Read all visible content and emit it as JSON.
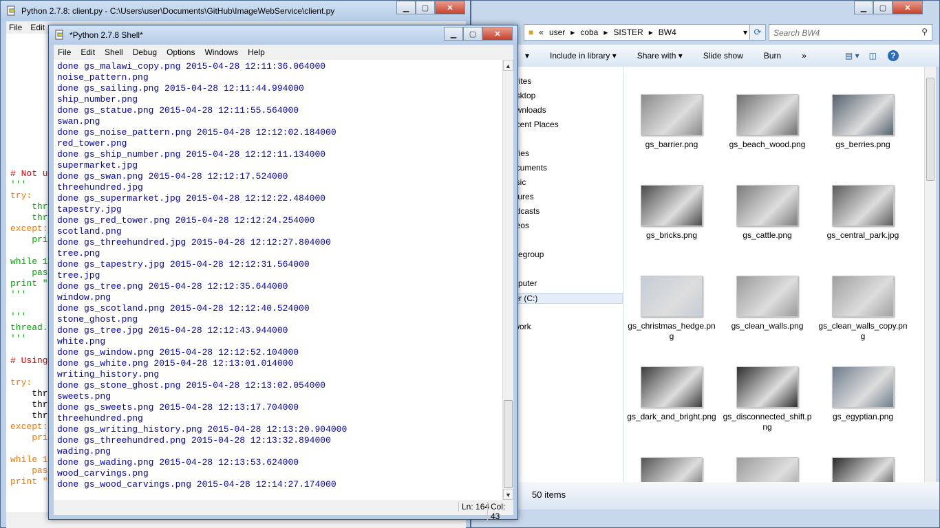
{
  "editor": {
    "title": "Python 2.7.8: client.py - C:\\Users\\user\\Documents\\GitHub\\ImageWebService\\client.py",
    "menu": [
      "File",
      "Edit"
    ],
    "code_lines": [
      {
        "text": "# Not u",
        "cls": "c-com"
      },
      {
        "text": "'''",
        "cls": "c-str"
      },
      {
        "text": "try:",
        "cls": "c-kw"
      },
      {
        "text": "    thre",
        "cls": "c-str"
      },
      {
        "text": "    thre",
        "cls": "c-str"
      },
      {
        "text": "except:",
        "cls": "c-kw"
      },
      {
        "text": "    pri",
        "cls": "c-str"
      },
      {
        "text": "",
        "cls": "c-pl"
      },
      {
        "text": "while 1",
        "cls": "c-str"
      },
      {
        "text": "    pas",
        "cls": "c-str"
      },
      {
        "text": "print \"",
        "cls": "c-str"
      },
      {
        "text": "'''",
        "cls": "c-str"
      },
      {
        "text": "",
        "cls": "c-pl"
      },
      {
        "text": "'''",
        "cls": "c-str"
      },
      {
        "text": "thread.",
        "cls": "c-str"
      },
      {
        "text": "'''",
        "cls": "c-str"
      },
      {
        "text": "",
        "cls": "c-pl"
      },
      {
        "text": "# Using",
        "cls": "c-com"
      },
      {
        "text": "",
        "cls": "c-pl"
      },
      {
        "text": "try:",
        "cls": "c-kw"
      },
      {
        "text": "    thr",
        "cls": "c-pl"
      },
      {
        "text": "    thr",
        "cls": "c-pl"
      },
      {
        "text": "    thr",
        "cls": "c-pl"
      },
      {
        "text": "except:",
        "cls": "c-kw"
      },
      {
        "text": "    pri",
        "cls": "c-kw"
      },
      {
        "text": "",
        "cls": "c-pl"
      },
      {
        "text": "while 1",
        "cls": "c-kw"
      },
      {
        "text": "    pas",
        "cls": "c-kw"
      },
      {
        "text": "print \"",
        "cls": "c-kw"
      }
    ]
  },
  "shell": {
    "title": "*Python 2.7.8 Shell*",
    "menu": [
      "File",
      "Edit",
      "Shell",
      "Debug",
      "Options",
      "Windows",
      "Help"
    ],
    "lines": [
      "done gs_malawi_copy.png 2015-04-28 12:11:36.064000",
      "noise_pattern.png",
      "done gs_sailing.png 2015-04-28 12:11:44.994000",
      "ship_number.png",
      "done gs_statue.png 2015-04-28 12:11:55.564000",
      "swan.png",
      "done gs_noise_pattern.png 2015-04-28 12:12:02.184000",
      "red_tower.png",
      "done gs_ship_number.png 2015-04-28 12:12:11.134000",
      "supermarket.jpg",
      "done gs_swan.png 2015-04-28 12:12:17.524000",
      "threehundred.jpg",
      "done gs_supermarket.jpg 2015-04-28 12:12:22.484000",
      "tapestry.jpg",
      "done gs_red_tower.png 2015-04-28 12:12:24.254000",
      "scotland.png",
      "done gs_threehundred.jpg 2015-04-28 12:12:27.804000",
      "tree.png",
      "done gs_tapestry.jpg 2015-04-28 12:12:31.564000",
      "tree.jpg",
      "done gs_tree.png 2015-04-28 12:12:35.644000",
      "window.png",
      "done gs_scotland.png 2015-04-28 12:12:40.524000",
      "stone_ghost.png",
      "done gs_tree.jpg 2015-04-28 12:12:43.944000",
      "white.png",
      "done gs_window.png 2015-04-28 12:12:52.104000",
      "done gs_white.png 2015-04-28 12:13:01.014000",
      "writing_history.png",
      "done gs_stone_ghost.png 2015-04-28 12:13:02.054000",
      "sweets.png",
      "done gs_sweets.png 2015-04-28 12:13:17.704000",
      "threehundred.png",
      "done gs_writing_history.png 2015-04-28 12:13:20.904000",
      "done gs_threehundred.png 2015-04-28 12:13:32.894000",
      "wading.png",
      "done gs_wading.png 2015-04-28 12:13:53.624000",
      "wood_carvings.png",
      "done gs_wood_carvings.png 2015-04-28 12:14:27.174000"
    ],
    "status_ln": "Ln: 164",
    "status_col": "Col: 43"
  },
  "explorer": {
    "breadcrumb": [
      "«",
      "user",
      "coba",
      "SISTER",
      "BW4"
    ],
    "search_placeholder": "Search BW4",
    "toolbar": {
      "include": "Include in library ▾",
      "share": "Share with ▾",
      "slideshow": "Slide show",
      "burn": "Burn",
      "more": "»"
    },
    "nav": [
      "orites",
      "esktop",
      "ownloads",
      "ecent Places",
      "aries",
      "ocuments",
      "usic",
      "ctures",
      "odcasts",
      "deos",
      "megroup",
      "mputer",
      "ter (C:)",
      "twork"
    ],
    "files": [
      {
        "name": "gs_barrier.png",
        "tone": "#8a8a8a"
      },
      {
        "name": "gs_beach_wood.png",
        "tone": "#6f6f6f"
      },
      {
        "name": "gs_berries.png",
        "tone": "#55626e"
      },
      {
        "name": "gs_bricks.png",
        "tone": "#4a4a4a"
      },
      {
        "name": "gs_cattle.png",
        "tone": "#7b7b7b"
      },
      {
        "name": "gs_central_park.jpg",
        "tone": "#5c5c5c"
      },
      {
        "name": "gs_christmas_hedge.png",
        "tone": "#c5cdd6"
      },
      {
        "name": "gs_clean_walls.png",
        "tone": "#9a9a9a"
      },
      {
        "name": "gs_clean_walls_copy.png",
        "tone": "#a0a0a0"
      },
      {
        "name": "gs_dark_and_bright.png",
        "tone": "#3d3d3d"
      },
      {
        "name": "gs_disconnected_shift.png",
        "tone": "#2f2f2f"
      },
      {
        "name": "gs_egyptian.png",
        "tone": "#6e7d8c"
      },
      {
        "name": "",
        "tone": "#555555"
      },
      {
        "name": "",
        "tone": "#9c9c9c"
      },
      {
        "name": "",
        "tone": "#2c2c2c"
      }
    ],
    "item_count": "50 items"
  }
}
